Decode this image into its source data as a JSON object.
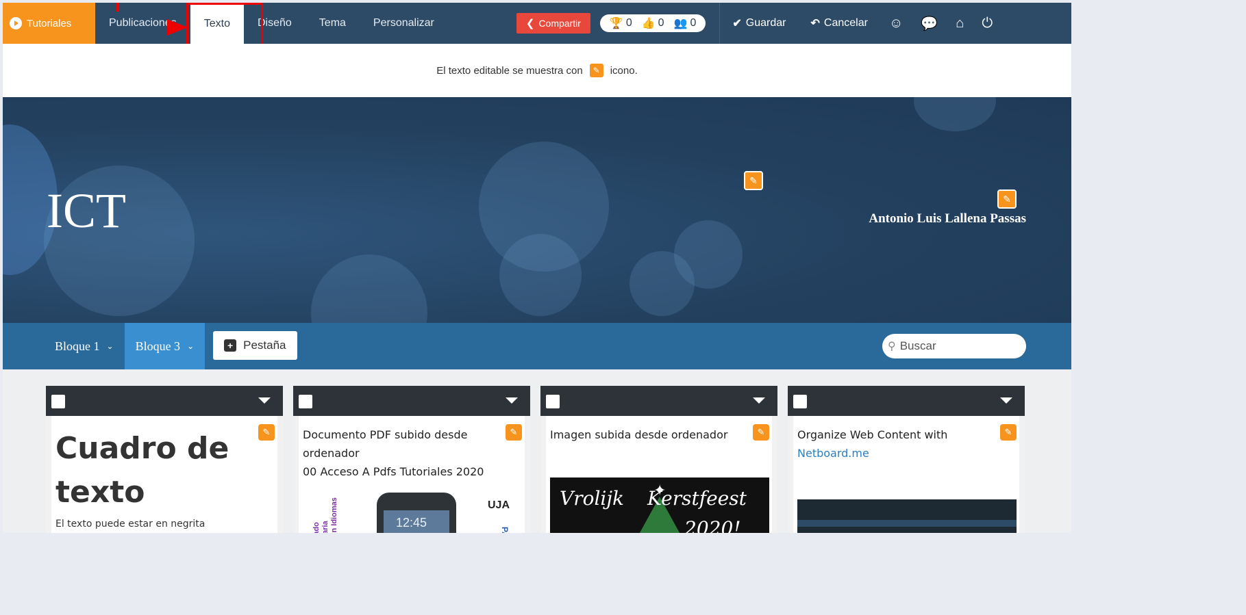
{
  "topbar": {
    "tutorials": "Tutoriales",
    "menu": [
      "Publicaciones",
      "Texto",
      "Diseño",
      "Tema",
      "Personalizar"
    ],
    "share": "Compartir",
    "stats": {
      "trophies": "0",
      "likes": "0",
      "followers": "0"
    },
    "save": "Guardar",
    "cancel": "Cancelar"
  },
  "info": {
    "before": "El texto editable se muestra con",
    "after": "icono."
  },
  "banner": {
    "title": "ICT",
    "author": "Antonio Luis Lallena Passas"
  },
  "tabs": {
    "items": [
      "Bloque 1",
      "Bloque 3"
    ],
    "add": "Pestaña",
    "search_placeholder": "Buscar"
  },
  "cards": [
    {
      "title_line1": "Cuadro de",
      "title_line2": "texto",
      "text": "El texto puede estar en negrita"
    },
    {
      "title_line1": "Documento PDF subido desde",
      "title_line2": "ordenador",
      "title_line3": "00 Acceso A Pdfs Tutoriales 2020",
      "brand": "UJA",
      "clock": "12:45",
      "side_text": "Profesorado\nUniversitaria\nFormación\nIdiomas",
      "vert": "PA"
    },
    {
      "title": "Imagen subida desde ordenador",
      "line1": "Vrolijk",
      "line2": "Kerstfeest",
      "line3": "2020!"
    },
    {
      "title_line1": "Organize Web Content with",
      "title_link": "Netboard.me"
    }
  ],
  "colors": {
    "topbar": "#2d4a67",
    "accent": "#f7941d",
    "share": "#e8473b",
    "tabs": "#2a6a9a",
    "tab_active": "#3a8fd0"
  }
}
